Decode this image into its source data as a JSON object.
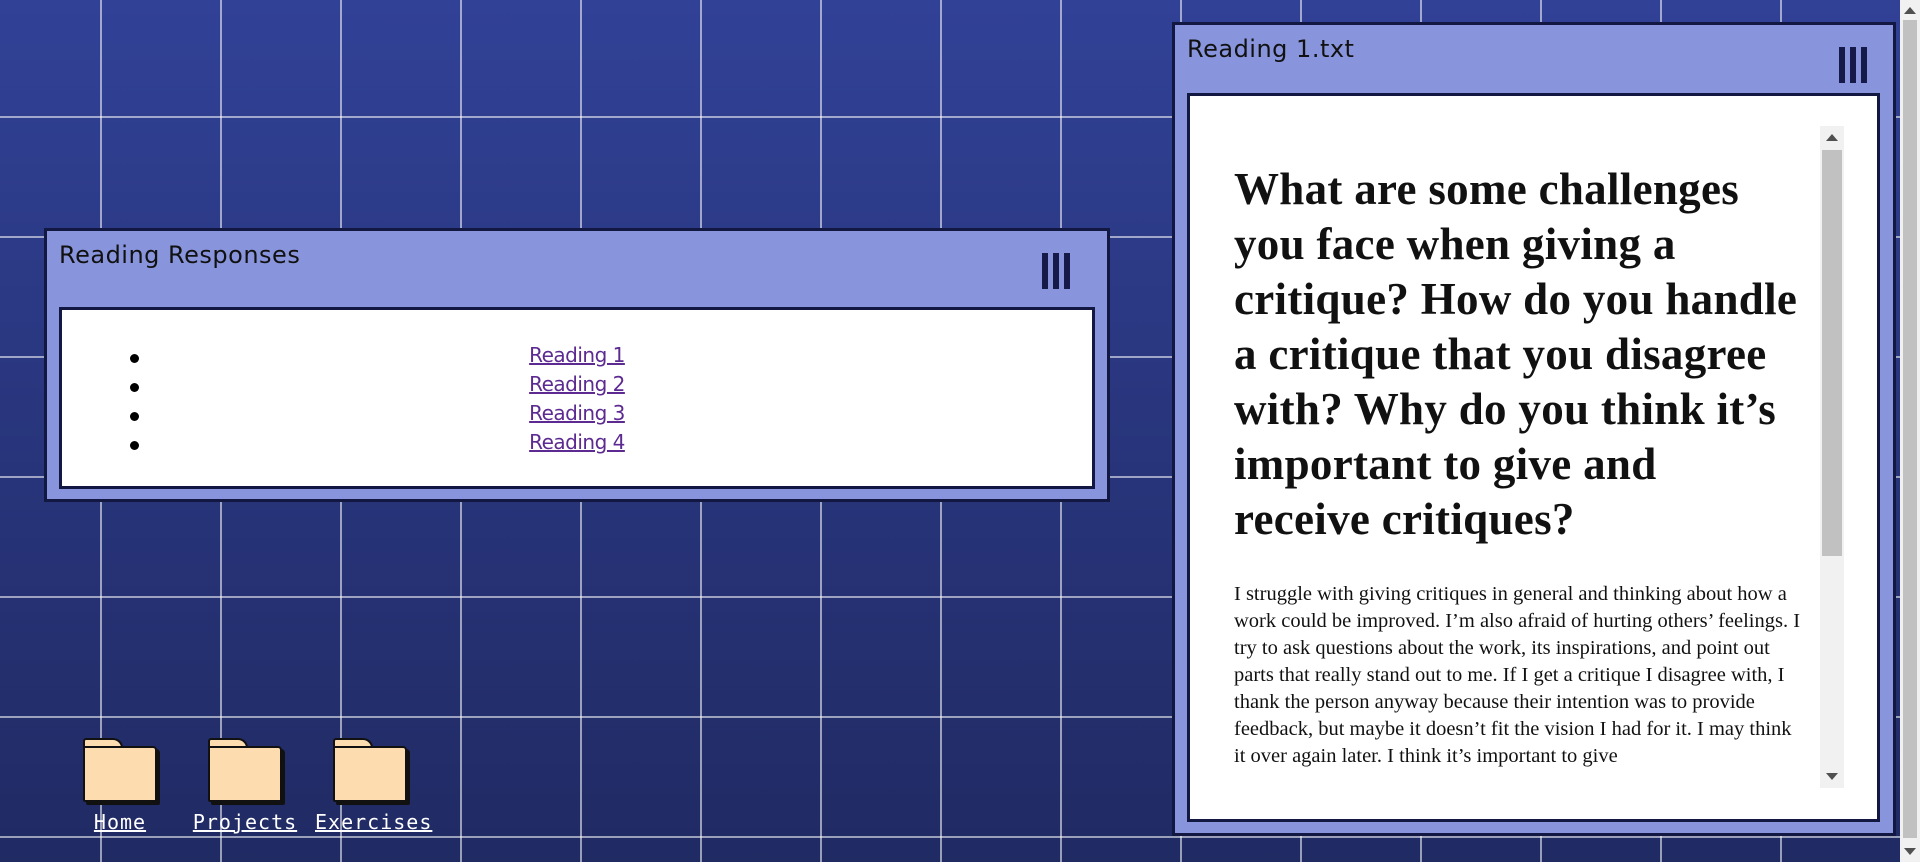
{
  "responses_window": {
    "title": "Reading Responses",
    "links": [
      "Reading 1",
      "Reading 2",
      "Reading 3",
      "Reading 4"
    ]
  },
  "reading_window": {
    "title": "Reading 1.txt",
    "heading": "What are some challenges you face when giving a critique? How do you handle a critique that you disagree with? Why do you think it’s important to give and receive critiques?",
    "body": "I struggle with giving critiques in general and thinking about how a work could be improved. I’m also afraid of hurting others’ feelings. I try to ask questions about the work, its inspirations, and point out parts that really stand out to me. If I get a critique I disagree with, I thank the person anyway because their intention was to provide feedback, but maybe it doesn’t fit the vision I had for it. I may think it over again later. I think it’s important to give"
  },
  "desktop": {
    "icons": [
      {
        "label": "Home",
        "icon": "folder-icon"
      },
      {
        "label": "Projects",
        "icon": "folder-icon"
      },
      {
        "label": "Exercises",
        "icon": "folder-icon"
      }
    ]
  },
  "colors": {
    "background": "#283377",
    "window": "#8895dc",
    "border": "#131843",
    "folder": "#fddcb0",
    "link": "#5c2a91"
  }
}
